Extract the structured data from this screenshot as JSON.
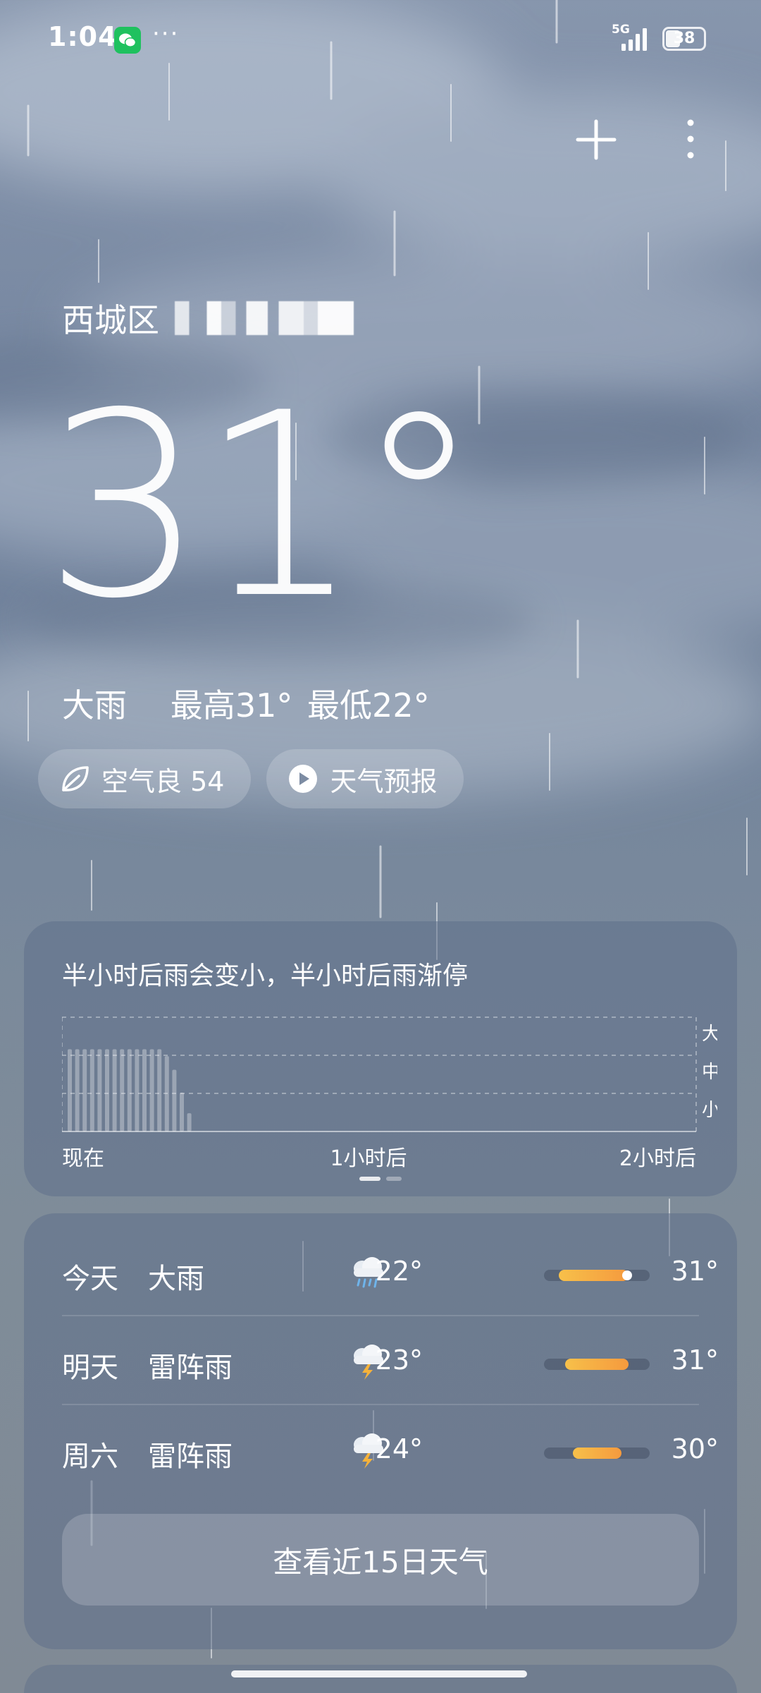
{
  "status_bar": {
    "time": "1:04",
    "network": "5G",
    "battery": "38"
  },
  "location": {
    "district": "西城区"
  },
  "current": {
    "temperature": "31°",
    "condition": "大雨",
    "high_label": "最高31°",
    "low_label": "最低22°"
  },
  "pills": {
    "air_quality": "空气良 54",
    "forecast_video": "天气预报"
  },
  "rain_forecast": {
    "title": "半小时后雨会变小，半小时后雨渐停",
    "x_labels": [
      "现在",
      "1小时后",
      "2小时后"
    ],
    "intensity_labels": [
      "大",
      "中",
      "小"
    ],
    "bars": [
      0.72,
      0.72,
      0.72,
      0.72,
      0.72,
      0.72,
      0.72,
      0.72,
      0.72,
      0.72,
      0.72,
      0.72,
      0.72,
      0.66,
      0.54,
      0.34,
      0.16,
      0.0
    ],
    "bar_count_total": 120
  },
  "daily": [
    {
      "day": "今天",
      "condition": "大雨",
      "icon": "heavy-rain-icon",
      "low": "22°",
      "high": "31°",
      "range_start": 0.14,
      "range_end": 0.8,
      "now": 0.8
    },
    {
      "day": "明天",
      "condition": "雷阵雨",
      "icon": "thunderstorm-icon",
      "low": "23°",
      "high": "31°",
      "range_start": 0.2,
      "range_end": 0.8,
      "now": null
    },
    {
      "day": "周六",
      "condition": "雷阵雨",
      "icon": "thunderstorm-icon",
      "low": "24°",
      "high": "30°",
      "range_start": 0.27,
      "range_end": 0.73,
      "now": null
    }
  ],
  "fifteen_day_button": "查看近15日天气",
  "colors": {
    "range_start": "#f7c04a",
    "range_end": "#f59a3e",
    "card_bg": "rgba(95,112,138,0.55)"
  }
}
